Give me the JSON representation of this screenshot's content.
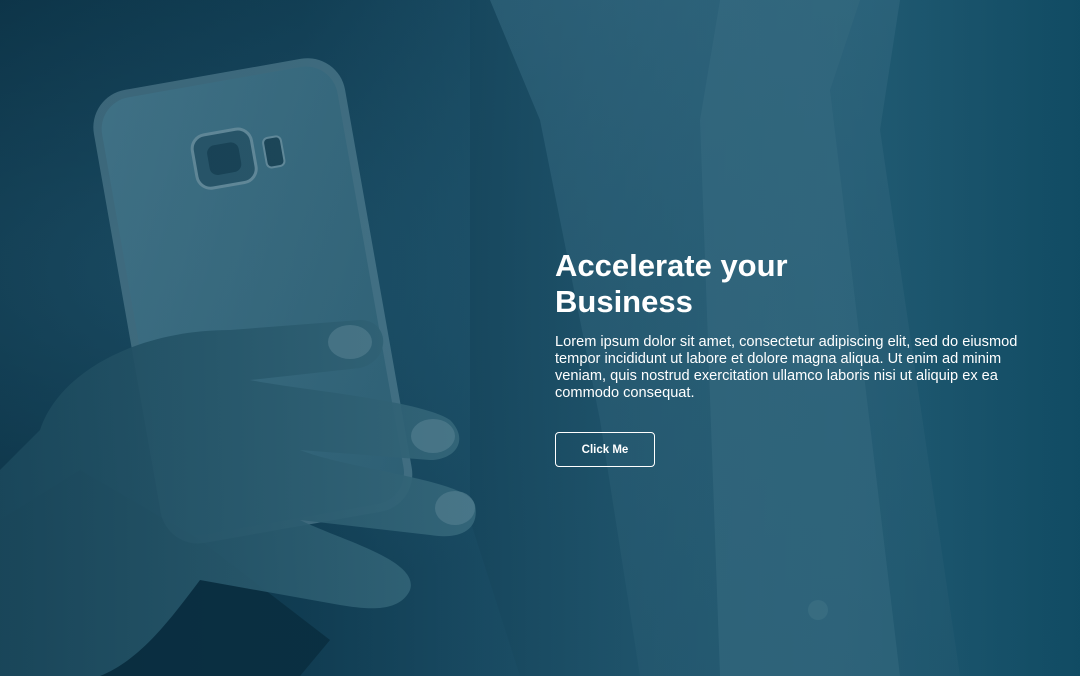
{
  "hero": {
    "headline_line_1": "Accelerate your",
    "headline_line_2": "Business",
    "description": "Lorem ipsum dolor sit amet, consectetur adipiscing elit, sed do eiusmod tempor incididunt ut labore et dolore magna aliqua. Ut enim ad minim veniam, quis nostrud exercitation ullamco laboris nisi ut aliquip ex ea commodo consequat.",
    "button_label": "Click Me"
  },
  "colors": {
    "overlay_teal": "#0d3549",
    "text": "#ffffff"
  }
}
